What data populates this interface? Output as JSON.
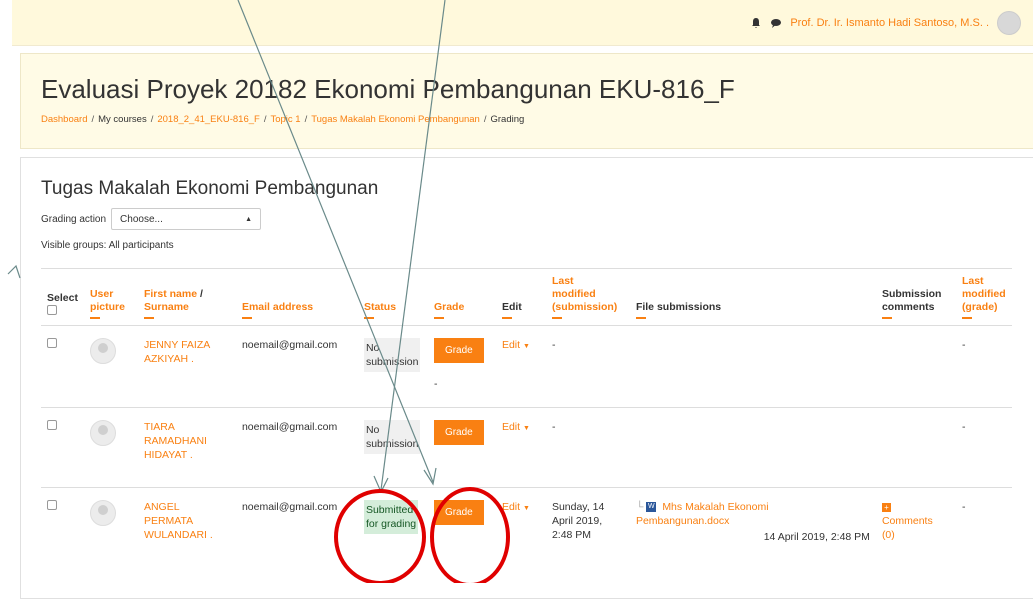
{
  "navbar": {
    "user_name": "Prof. Dr. Ir. Ismanto Hadi Santoso, M.S. ."
  },
  "header": {
    "course_title": "Evaluasi Proyek 20182 Ekonomi Pembangunan EKU-816_F",
    "breadcrumb": {
      "dashboard": "Dashboard",
      "my_courses": "My courses",
      "course": "2018_2_41_EKU-816_F",
      "topic": "Topic 1",
      "assignment": "Tugas Makalah Ekonomi Pembangunan",
      "current": "Grading"
    }
  },
  "main": {
    "title": "Tugas Makalah Ekonomi Pembangunan",
    "grading_action_label": "Grading action",
    "grading_action_value": "Choose...",
    "visible_groups": "Visible groups: All participants",
    "columns": {
      "select": "Select",
      "user_picture_1": "User",
      "user_picture_2": "picture",
      "first_name": "First name",
      "surname": "Surname",
      "email": "Email address",
      "status": "Status",
      "grade": "Grade",
      "edit": "Edit",
      "last_modified_sub_1": "Last",
      "last_modified_sub_2": "modified",
      "last_modified_sub_3": "(submission)",
      "file_submissions": "File submissions",
      "submission_comments_1": "Submission",
      "submission_comments_2": "comments",
      "last_modified_grade_1": "Last",
      "last_modified_grade_2": "modified",
      "last_modified_grade_3": "(grade)"
    },
    "rows": [
      {
        "name_1": "JENNY FAIZA",
        "name_2": "AZKIYAH .",
        "name_3": "",
        "email": "noemail@gmail.com",
        "status_1": "No",
        "status_2": "submission",
        "grade_button": "Grade",
        "grade_value": "-",
        "edit": "Edit",
        "last_modified": "-",
        "last_modified_grade": "-"
      },
      {
        "name_1": "TIARA",
        "name_2": "RAMADHANI",
        "name_3": "HIDAYAT .",
        "email": "noemail@gmail.com",
        "status_1": "No",
        "status_2": "submission",
        "grade_button": "Grade",
        "edit": "Edit",
        "last_modified": "-",
        "last_modified_grade": "-"
      },
      {
        "name_1": "ANGEL",
        "name_2": "PERMATA",
        "name_3": "WULANDARI .",
        "email": "noemail@gmail.com",
        "status_1": "Submitted",
        "status_2": "for grading",
        "grade_button": "Grade",
        "edit": "Edit",
        "last_modified_1": "Sunday, 14",
        "last_modified_2": "April 2019,",
        "last_modified_3": "2:48 PM",
        "file_name_1": "Mhs Makalah Ekonomi",
        "file_name_2": "Pembangunan.docx",
        "file_date": "14 April 2019, 2:48 PM",
        "comments_1": "Comments",
        "comments_2": "(0)",
        "last_modified_grade": "-"
      }
    ]
  },
  "colors": {
    "accent": "#f98012",
    "annotation_red": "#e00000",
    "arrow": "#6a8a8a"
  }
}
